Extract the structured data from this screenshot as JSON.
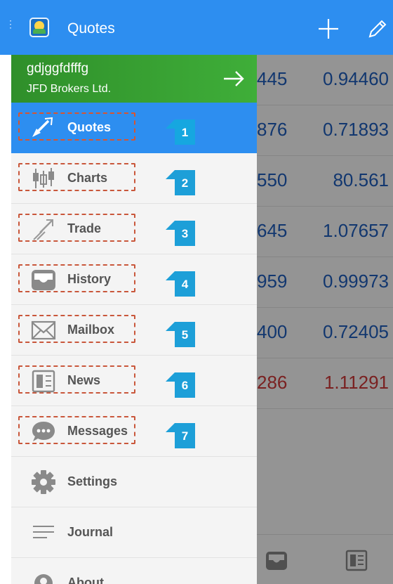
{
  "header": {
    "title": "Quotes",
    "add_icon": "plus-icon",
    "edit_icon": "pencil-icon",
    "accent": "#2d8ef0"
  },
  "account": {
    "login": "gdjggfdfffg",
    "broker": "JFD Brokers Ltd."
  },
  "menu": [
    {
      "label": "Quotes",
      "icon": "quotes-icon",
      "badge": "1",
      "active": true
    },
    {
      "label": "Charts",
      "icon": "candlestick-icon",
      "badge": "2"
    },
    {
      "label": "Trade",
      "icon": "trade-icon",
      "badge": "3"
    },
    {
      "label": "History",
      "icon": "history-tray-icon",
      "badge": "4"
    },
    {
      "label": "Mailbox",
      "icon": "envelope-icon",
      "badge": "5"
    },
    {
      "label": "News",
      "icon": "newspaper-icon",
      "badge": "6"
    },
    {
      "label": "Messages",
      "icon": "chat-bubble-icon",
      "badge": "7"
    },
    {
      "label": "Settings",
      "icon": "gear-icon"
    },
    {
      "label": "Journal",
      "icon": "journal-lines-icon"
    },
    {
      "label": "About",
      "icon": "about-icon"
    }
  ],
  "quotes": [
    {
      "bid": "445",
      "ask": "0.94460"
    },
    {
      "bid": "876",
      "ask": "0.71893"
    },
    {
      "bid": "550",
      "ask": "80.561"
    },
    {
      "bid": "645",
      "ask": "1.07657"
    },
    {
      "bid": "959",
      "ask": "0.99973"
    },
    {
      "bid": "400",
      "ask": "0.72405"
    },
    {
      "bid": "286",
      "ask": "1.11291",
      "negative": true
    }
  ],
  "colors": {
    "quote_up": "#1f5fbf",
    "quote_down": "#d23a3a",
    "badge": "#1d9fd8",
    "highlight_box": "#c9573b",
    "account_bg": "#3fae39"
  }
}
